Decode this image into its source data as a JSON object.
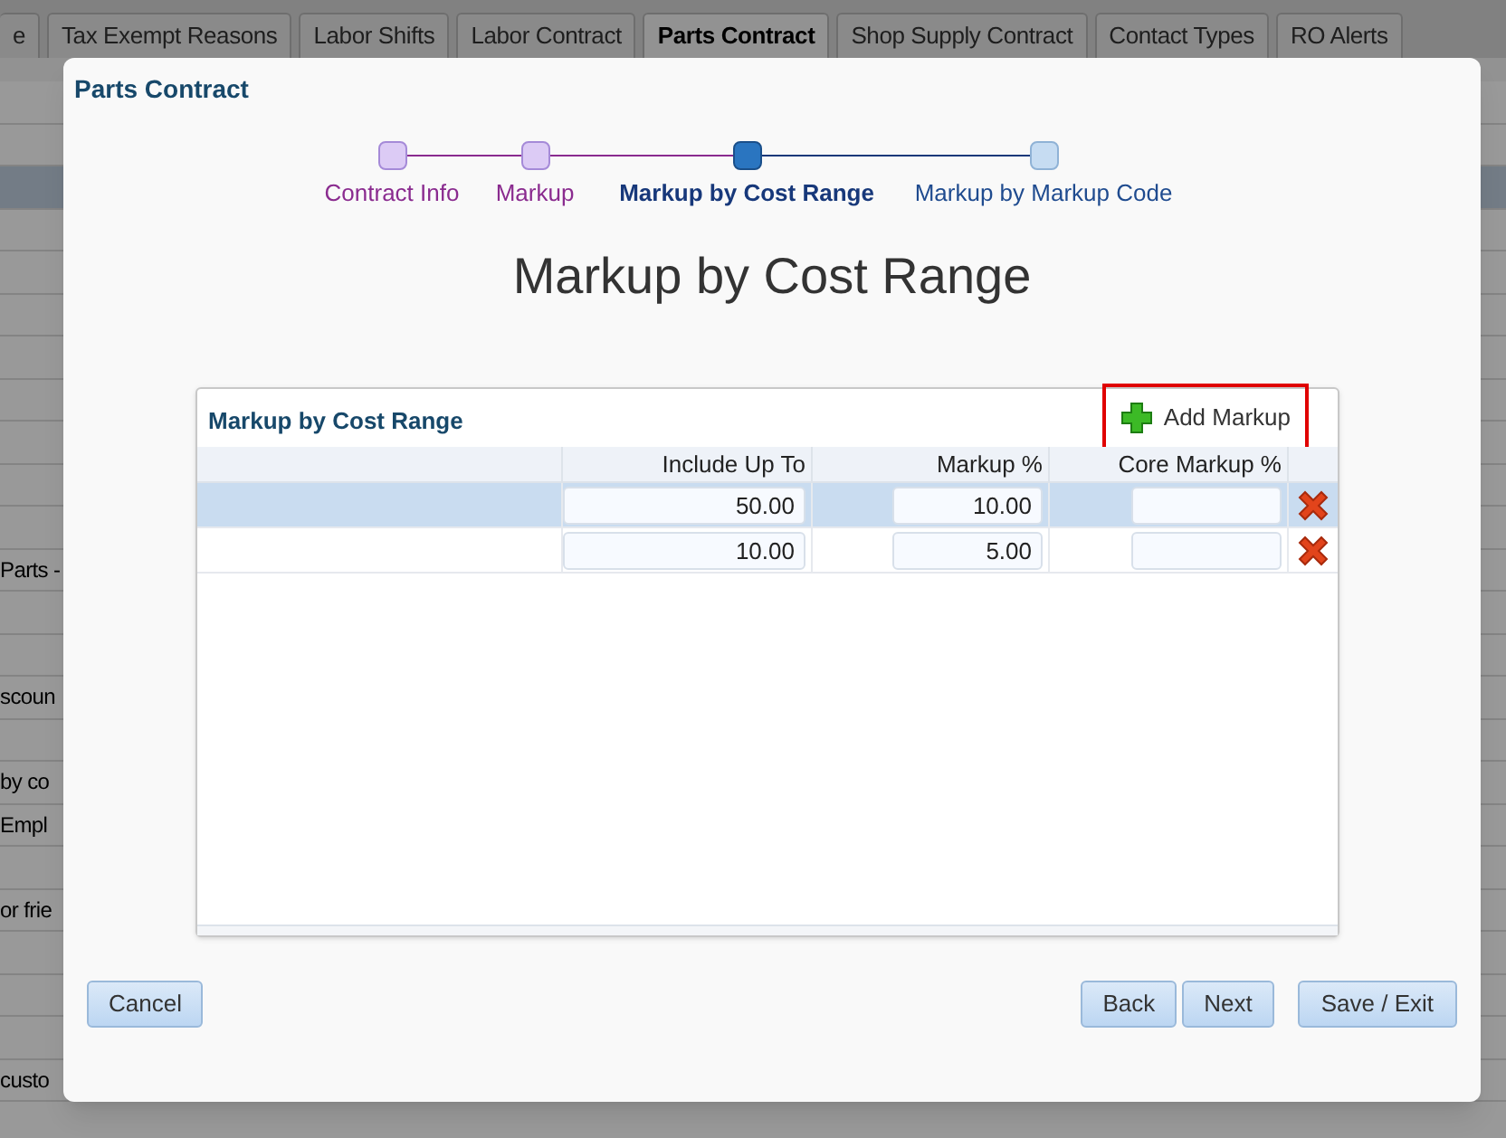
{
  "background": {
    "tabs": [
      {
        "label": "e",
        "selected": false
      },
      {
        "label": "Tax Exempt Reasons",
        "selected": false
      },
      {
        "label": "Labor Shifts",
        "selected": false
      },
      {
        "label": "Labor Contract",
        "selected": false
      },
      {
        "label": "Parts Contract",
        "selected": true
      },
      {
        "label": "Shop Supply Contract",
        "selected": false
      },
      {
        "label": "Contact Types",
        "selected": false
      },
      {
        "label": "RO Alerts",
        "selected": false
      }
    ],
    "rows": [
      {
        "kind": "plain"
      },
      {
        "kind": "plain"
      },
      {
        "kind": "header"
      },
      {
        "kind": "plain"
      },
      {
        "kind": "plain"
      },
      {
        "kind": "plain"
      },
      {
        "kind": "plain"
      },
      {
        "kind": "plain"
      },
      {
        "kind": "plain"
      },
      {
        "kind": "plain"
      },
      {
        "kind": "plain"
      },
      {
        "kind": "plain",
        "text": "Parts -"
      },
      {
        "kind": "plain"
      },
      {
        "kind": "plain"
      },
      {
        "kind": "plain",
        "text": "scoun"
      },
      {
        "kind": "plain"
      },
      {
        "kind": "plain",
        "text": "by co"
      },
      {
        "kind": "plain",
        "text": "Empl"
      },
      {
        "kind": "plain"
      },
      {
        "kind": "plain",
        "text": "or frie"
      },
      {
        "kind": "plain"
      },
      {
        "kind": "plain"
      },
      {
        "kind": "plain"
      },
      {
        "kind": "plain",
        "text": "custo"
      },
      {
        "kind": "plain"
      }
    ]
  },
  "dialog": {
    "title": "Parts Contract",
    "steps": [
      {
        "label": "Contract Info",
        "completed": true,
        "selected": false
      },
      {
        "label": "Markup",
        "completed": true,
        "selected": false
      },
      {
        "label": "Markup by Cost Range",
        "completed": false,
        "selected": true
      },
      {
        "label": "Markup by Markup Code",
        "completed": false,
        "selected": false
      }
    ],
    "heading": "Markup by Cost Range",
    "grid": {
      "title": "Markup by Cost Range",
      "add_button": "Add Markup",
      "columns": [
        "Include Up To",
        "Markup %",
        "Core Markup %"
      ],
      "rows": [
        {
          "selected": true,
          "include_up_to": "50.00",
          "markup": "10.00"
        },
        {
          "selected": false,
          "include_up_to": "10.00",
          "markup": "5.00"
        }
      ]
    },
    "buttons": {
      "cancel": "Cancel",
      "back": "Back",
      "next": "Next",
      "save": "Save / Exit"
    }
  }
}
